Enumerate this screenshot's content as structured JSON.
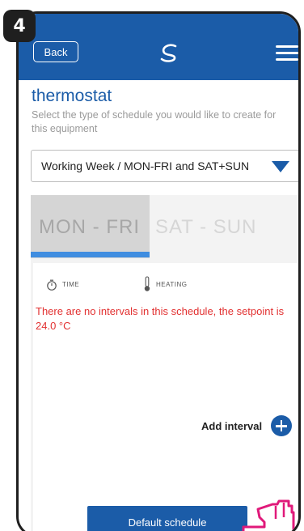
{
  "step": "4",
  "header": {
    "back_label": "Back",
    "logo_icon": "salus-logo-icon",
    "menu_icon": "hamburger-menu-icon"
  },
  "page": {
    "title": "thermostat",
    "subtitle": "Select the type of schedule you would like to create for this equipment"
  },
  "schedule_type": {
    "selected": "Working Week / MON-FRI and SAT+SUN",
    "arrow_icon": "dropdown-triangle-icon"
  },
  "tabs": [
    {
      "label": "MON - FRI",
      "active": true
    },
    {
      "label": "SAT - SUN",
      "active": false
    }
  ],
  "columns": {
    "time_label": "TIME",
    "time_icon": "stopwatch-icon",
    "heating_label": "HEATING",
    "heating_icon": "thermometer-icon"
  },
  "empty_message": "There are no intervals in this schedule, the setpoint is 24.0 °C",
  "add_interval_label": "Add interval",
  "default_schedule_label": "Default schedule",
  "colors": {
    "brand_blue": "#1b5ca8",
    "accent_blue": "#3f8de0",
    "error_red": "#e23131"
  }
}
